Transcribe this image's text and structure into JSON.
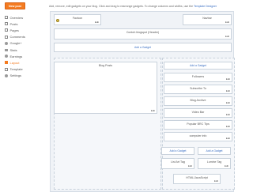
{
  "sidebar": {
    "new_post_label": "New post",
    "nav": [
      {
        "label": "Overview",
        "icon": "overview-icon",
        "active": false
      },
      {
        "label": "Posts",
        "icon": "posts-icon",
        "active": false
      },
      {
        "label": "Pages",
        "icon": "pages-icon",
        "active": false
      },
      {
        "label": "Comments",
        "icon": "comments-icon",
        "active": false
      },
      {
        "label": "Google+",
        "icon": "google-plus-icon",
        "active": false
      },
      {
        "label": "Stats",
        "icon": "stats-icon",
        "active": false
      },
      {
        "label": "Earnings",
        "icon": "earnings-icon",
        "active": false
      },
      {
        "label": "Layout",
        "icon": "layout-icon",
        "active": true
      },
      {
        "label": "Template",
        "icon": "template-icon",
        "active": false
      },
      {
        "label": "Settings",
        "icon": "settings-icon",
        "active": false
      }
    ]
  },
  "hint": {
    "text": "Add, remove, edit gadgets on your blog. Click and drag to rearrange gadgets. To change columns and widths, use the ",
    "link": "Template Designer"
  },
  "layout": {
    "favicon": {
      "title": "Favicon",
      "edit": "Edit"
    },
    "navbar": {
      "title": "Navbar",
      "edit": "Edit"
    },
    "header": {
      "title": "Contoh blogspot (Header)",
      "edit": "Edit"
    },
    "add_gadget": "Add a Gadget",
    "blog_posts": {
      "title": "Blog Posts",
      "edit": "Edit"
    },
    "sidebar_widgets": [
      {
        "title": "Followers",
        "edit": "Edit"
      },
      {
        "title": "Subscribe To",
        "edit": "Edit"
      },
      {
        "title": "Blog Archive",
        "edit": "Edit"
      },
      {
        "title": "Video Bar",
        "edit": "Edit"
      },
      {
        "title": "Popular BRC Tips",
        "edit": "Edit"
      },
      {
        "title": "computer info",
        "edit": "Edit"
      }
    ],
    "footer_left": {
      "title": "List Art Tag",
      "edit": "Edit"
    },
    "footer_right": {
      "title": "Lumine Tag",
      "edit": "Edit"
    },
    "attribution": {
      "title": "HTML/JavaScript",
      "edit": "Edit"
    }
  },
  "colors": {
    "accent": "#f47b20",
    "link": "#3a6fc3",
    "canvas": "#f0f3f7"
  }
}
